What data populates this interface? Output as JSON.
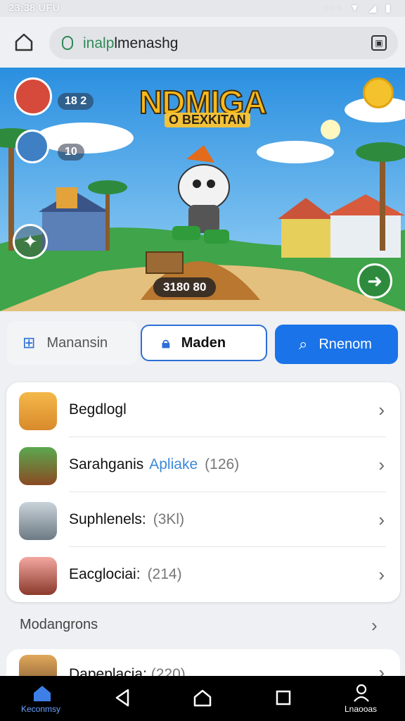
{
  "status_bar": {
    "time": "23:38 UFU",
    "icons": "◦◦◦ ▼ ◢ ▮"
  },
  "address_bar": {
    "url_highlight": "inalp",
    "url_rest": "lmenashg"
  },
  "hero": {
    "game_title": "NDMIGA",
    "game_subtitle": "O BEXKITAN",
    "badge_top": "18 2",
    "badge_second": "10",
    "score": "3180  80"
  },
  "segments": [
    {
      "label": "Manansin",
      "icon": "grid-icon"
    },
    {
      "label": "Maden",
      "icon": "lock-icon"
    },
    {
      "label": "Rnenom",
      "icon": "search-icon"
    }
  ],
  "list": [
    {
      "name": "Begdlogl",
      "tag": "",
      "count": ""
    },
    {
      "name": "Sarahganis",
      "tag": "Apliake",
      "count": "(126)"
    },
    {
      "name": "Suphlenels:",
      "tag": "",
      "count": "(3Kl)"
    },
    {
      "name": "Eacglociai:",
      "tag": "",
      "count": "(214)"
    }
  ],
  "section_title": "Modangrons",
  "partial_item": {
    "name": "Dapeplacia:",
    "count": "(220)"
  },
  "bottom_nav": {
    "left_label": "Keconmsy",
    "right_label": "Lnaooas"
  },
  "colors": {
    "accent": "#1a73e8",
    "secure": "#2f8a55"
  }
}
